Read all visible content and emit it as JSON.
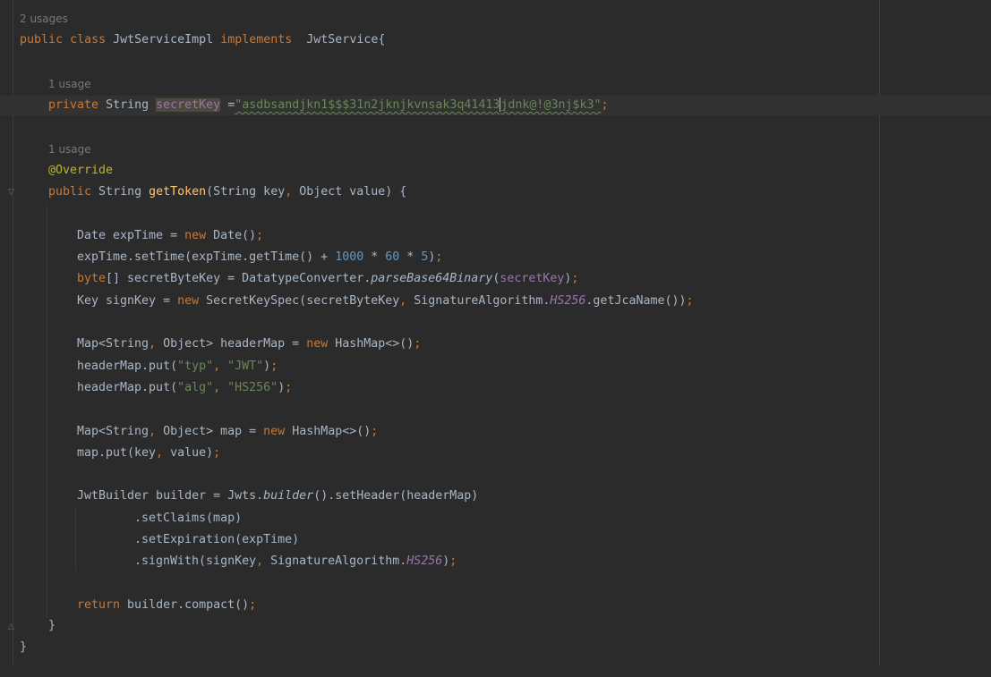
{
  "editor": {
    "usage_hints": {
      "class": "2 usages",
      "field": "1 usage",
      "method": "1 usage"
    },
    "class_decl": {
      "public": "public",
      "class": "class",
      "name": "JwtServiceImpl",
      "implements": "implements",
      "iface": "JwtService{"
    },
    "field": {
      "private": "private",
      "type": "String",
      "name": "secretKey",
      "eq": " =",
      "value_a": "\"asdbsandjkn1$$$31n2jknjkvnsak3q41413",
      "value_b": "jdnk@!@3nj$k3\"",
      "semi": ";"
    },
    "method": {
      "annotation": "@Override",
      "public": "public",
      "ret": " String ",
      "name": "getToken",
      "params_a": "(String key",
      "comma": ",",
      "params_b": " Object value) {"
    },
    "lines": {
      "l1": {
        "a": "Date expTime = ",
        "kw": "new",
        "b": " Date()",
        "s": ";"
      },
      "l2": {
        "a": "expTime.setTime(expTime.getTime() + ",
        "n1": "1000",
        "m1": " * ",
        "n2": "60",
        "m2": " * ",
        "n3": "5",
        "b": ")",
        "s": ";"
      },
      "l3": {
        "kw": "byte",
        "a": "[] secretByteKey = DatatypeConverter.",
        "fn": "parseBase64Binary",
        "b": "(",
        "f": "secretKey",
        "c": ")",
        "s": ";"
      },
      "l4": {
        "a": "Key signKey = ",
        "kw": "new",
        "b": " SecretKeySpec(secretByteKey",
        "c1": ",",
        "d": " SignatureAlgorithm.",
        "sf": "HS256",
        "e": ".getJcaName())",
        "s": ";"
      },
      "l5": {
        "a": "Map<String",
        "c1": ",",
        "b": " Object> headerMap = ",
        "kw": "new",
        "c": " HashMap<>()",
        "s": ";"
      },
      "l6": {
        "a": "headerMap.put(",
        "s1": "\"typ\"",
        "c1": ",",
        "sp": " ",
        "s2": "\"JWT\"",
        "b": ")",
        "s": ";"
      },
      "l7": {
        "a": "headerMap.put(",
        "s1": "\"alg\"",
        "c1": ",",
        "sp": " ",
        "s2": "\"HS256\"",
        "b": ")",
        "s": ";"
      },
      "l8": {
        "a": "Map<String",
        "c1": ",",
        "b": " Object> map = ",
        "kw": "new",
        "c": " HashMap<>()",
        "s": ";"
      },
      "l9": {
        "a": "map.put(key",
        "c1": ",",
        "b": " value)",
        "s": ";"
      },
      "l10": {
        "a": "JwtBuilder builder = Jwts.",
        "fn": "builder",
        "b": "().setHeader(headerMap)"
      },
      "l11": {
        "a": ".setClaims(map)"
      },
      "l12": {
        "a": ".setExpiration(expTime)"
      },
      "l13": {
        "a": ".signWith(signKey",
        "c1": ",",
        "b": " SignatureAlgorithm.",
        "sf": "HS256",
        "c": ")",
        "s": ";"
      },
      "l14": {
        "kw": "return",
        "a": " builder.compact()",
        "s": ";"
      },
      "close_method": "}",
      "close_class": "}"
    }
  },
  "colors": {
    "background": "#2b2b2b",
    "keyword": "#cc7832",
    "string": "#6a8759",
    "number": "#6897bb",
    "field": "#9876aa",
    "function": "#ffc66d",
    "annotation": "#bbb529",
    "text": "#a9b7c6"
  },
  "icons": {
    "fold_start": "fold-icon",
    "fold_end": "fold-end-icon"
  }
}
